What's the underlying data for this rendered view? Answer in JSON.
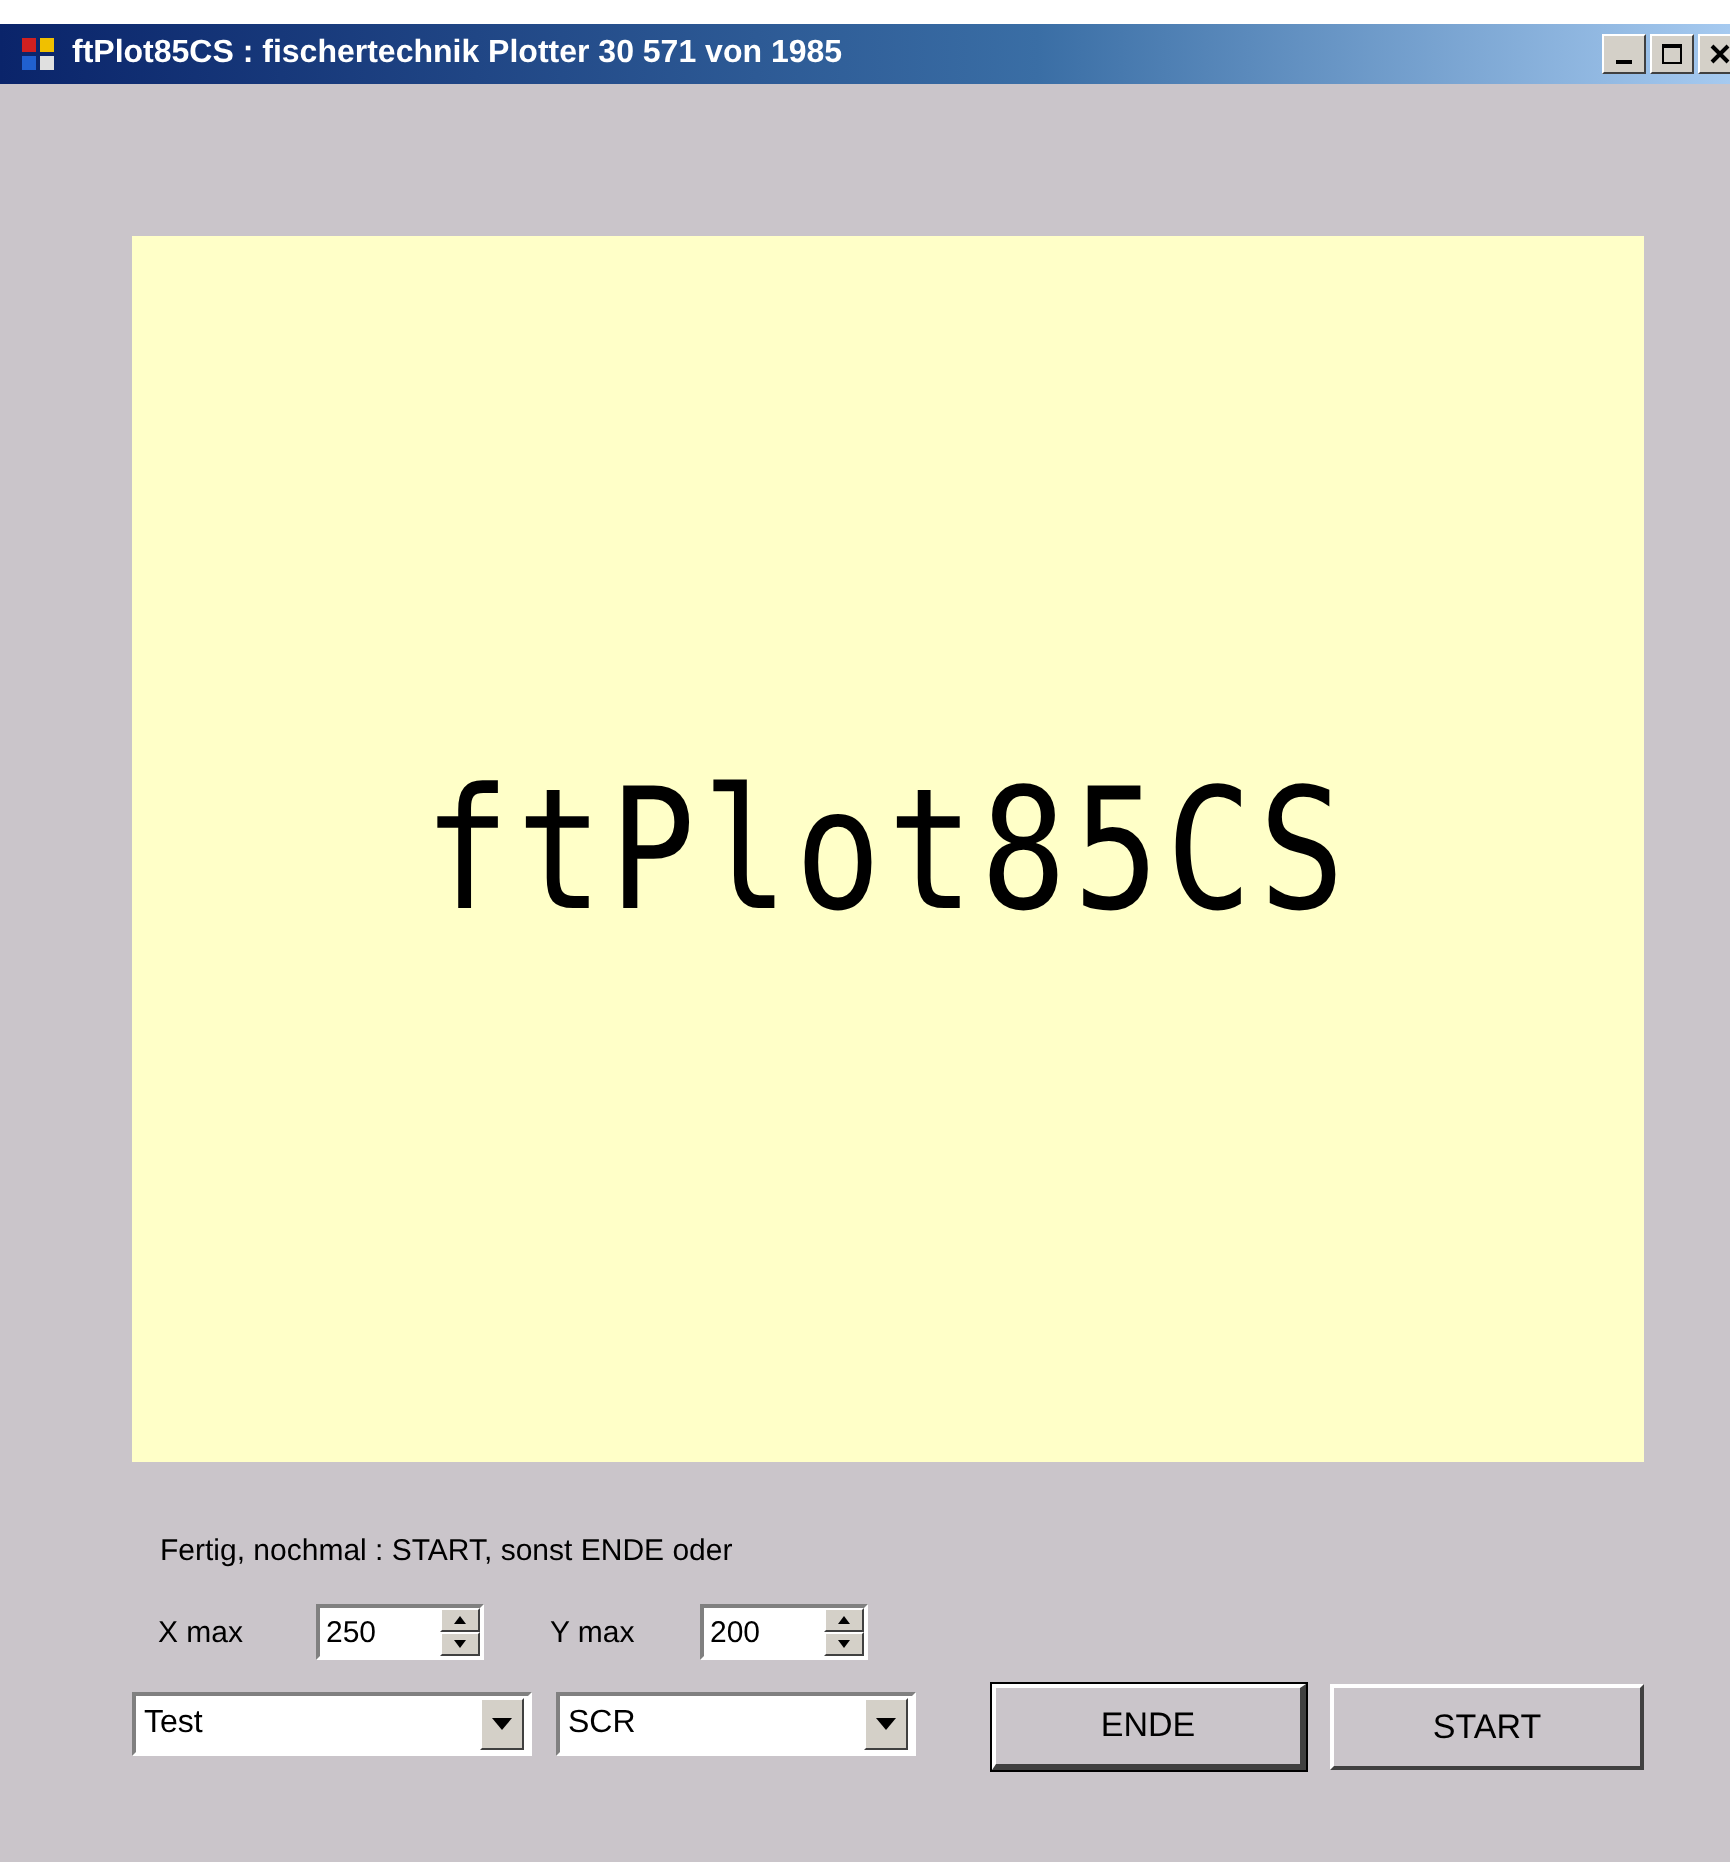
{
  "window": {
    "title": "ftPlot85CS : fischertechnik Plotter 30 571 von 1985"
  },
  "plot": {
    "text": "ftPlot85CS"
  },
  "status": "Fertig, nochmal : START, sonst ENDE oder",
  "spinners": [
    {
      "label": "X max",
      "value": "250"
    },
    {
      "label": "Y max",
      "value": "200"
    }
  ],
  "dropdowns": [
    {
      "value": "Test"
    },
    {
      "value": "SCR"
    }
  ],
  "buttons": [
    {
      "label": "ENDE",
      "default": true
    },
    {
      "label": "START",
      "default": false
    }
  ]
}
